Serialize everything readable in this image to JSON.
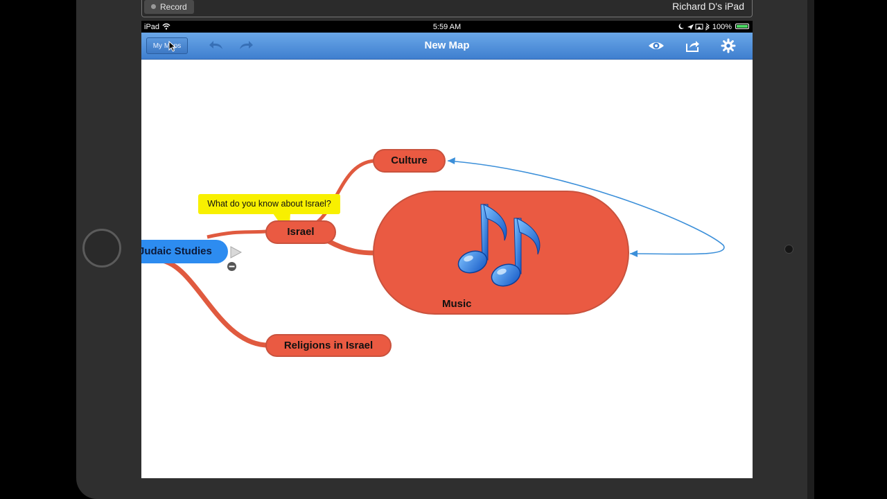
{
  "recorder": {
    "record_label": "Record",
    "device_name": "Richard D's iPad"
  },
  "status_bar": {
    "carrier": "iPad",
    "time": "5:59 AM",
    "battery": "100%"
  },
  "toolbar": {
    "my_maps_label": "My Maps",
    "title": "New Map",
    "icons": [
      "undo-icon",
      "redo-icon",
      "eye-icon",
      "share-icon",
      "gear-icon"
    ]
  },
  "mind_map": {
    "central_topic": "Judaic Studies",
    "nodes": {
      "israel": "Israel",
      "culture": "Culture",
      "music": "Music",
      "religions": "Religions in Israel"
    },
    "callout": "What do you know about Israel?",
    "colors": {
      "topic": "#ea5a42",
      "central": "#2d8cf0",
      "branch": "#e05a3f",
      "relationship": "#3b8fd9",
      "callout": "#f8f000"
    }
  }
}
